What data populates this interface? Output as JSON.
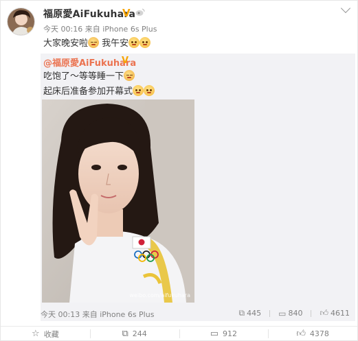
{
  "post": {
    "author": "福原愛AiFukuhara",
    "verified_badge": "V",
    "meta": "今天 00:16 来自 iPhone 6s Plus",
    "text_a": "大家晚安啦",
    "text_b": " 我午安",
    "emoji": [
      "sleepy-face",
      "blush-face",
      "blush-face"
    ]
  },
  "repost": {
    "author": "@福原愛AiFukuhara",
    "verified_badge": "V",
    "line1": "吃饱了～等等睡一下",
    "line2": "起床后准备参加开幕式",
    "photo_watermark": "weibo.com/aifukuhara",
    "meta": "今天 00:13 来自 iPhone 6s Plus",
    "actions": {
      "repost": "445",
      "comment": "840",
      "like": "4611"
    }
  },
  "bottom": {
    "favorite": "收藏",
    "repost": "244",
    "comment": "912",
    "like": "4378"
  },
  "colors": {
    "link": "#eb7350",
    "badge": "#f7a400",
    "meta": "#808080"
  },
  "icons": [
    "chevron-down-icon",
    "repost-icon",
    "comment-icon",
    "like-icon",
    "favorite-icon",
    "weibo-icon"
  ]
}
